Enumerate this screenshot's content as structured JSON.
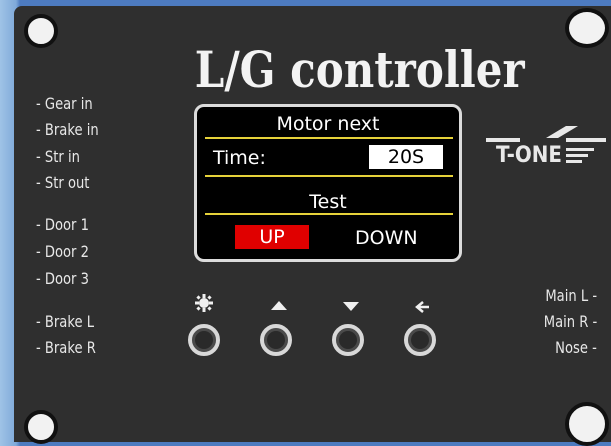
{
  "title": "L/G controller",
  "left_labels": [
    "- Gear in",
    "- Brake in",
    "- Str in",
    "- Str out",
    "- Door 1",
    "- Door 2",
    "- Door 3",
    "- Brake L",
    "- Brake R"
  ],
  "right_labels": [
    "Main L  -",
    "Main R -",
    "Nose    -"
  ],
  "screen": {
    "header": "Motor next",
    "time_label": "Time:",
    "time_value": "20S",
    "mode": "Test",
    "up_label": "UP",
    "down_label": "DOWN"
  },
  "logo": {
    "text": "T-ONE",
    "icon": "t-one-logo"
  },
  "buttons": [
    {
      "icon": "gear-icon"
    },
    {
      "icon": "triangle-up-icon"
    },
    {
      "icon": "triangle-down-icon"
    },
    {
      "icon": "arrow-left-icon"
    }
  ],
  "colors": {
    "panel": "#2f2f2f",
    "accent_line": "#e6d23a",
    "selection": "#e00000"
  }
}
